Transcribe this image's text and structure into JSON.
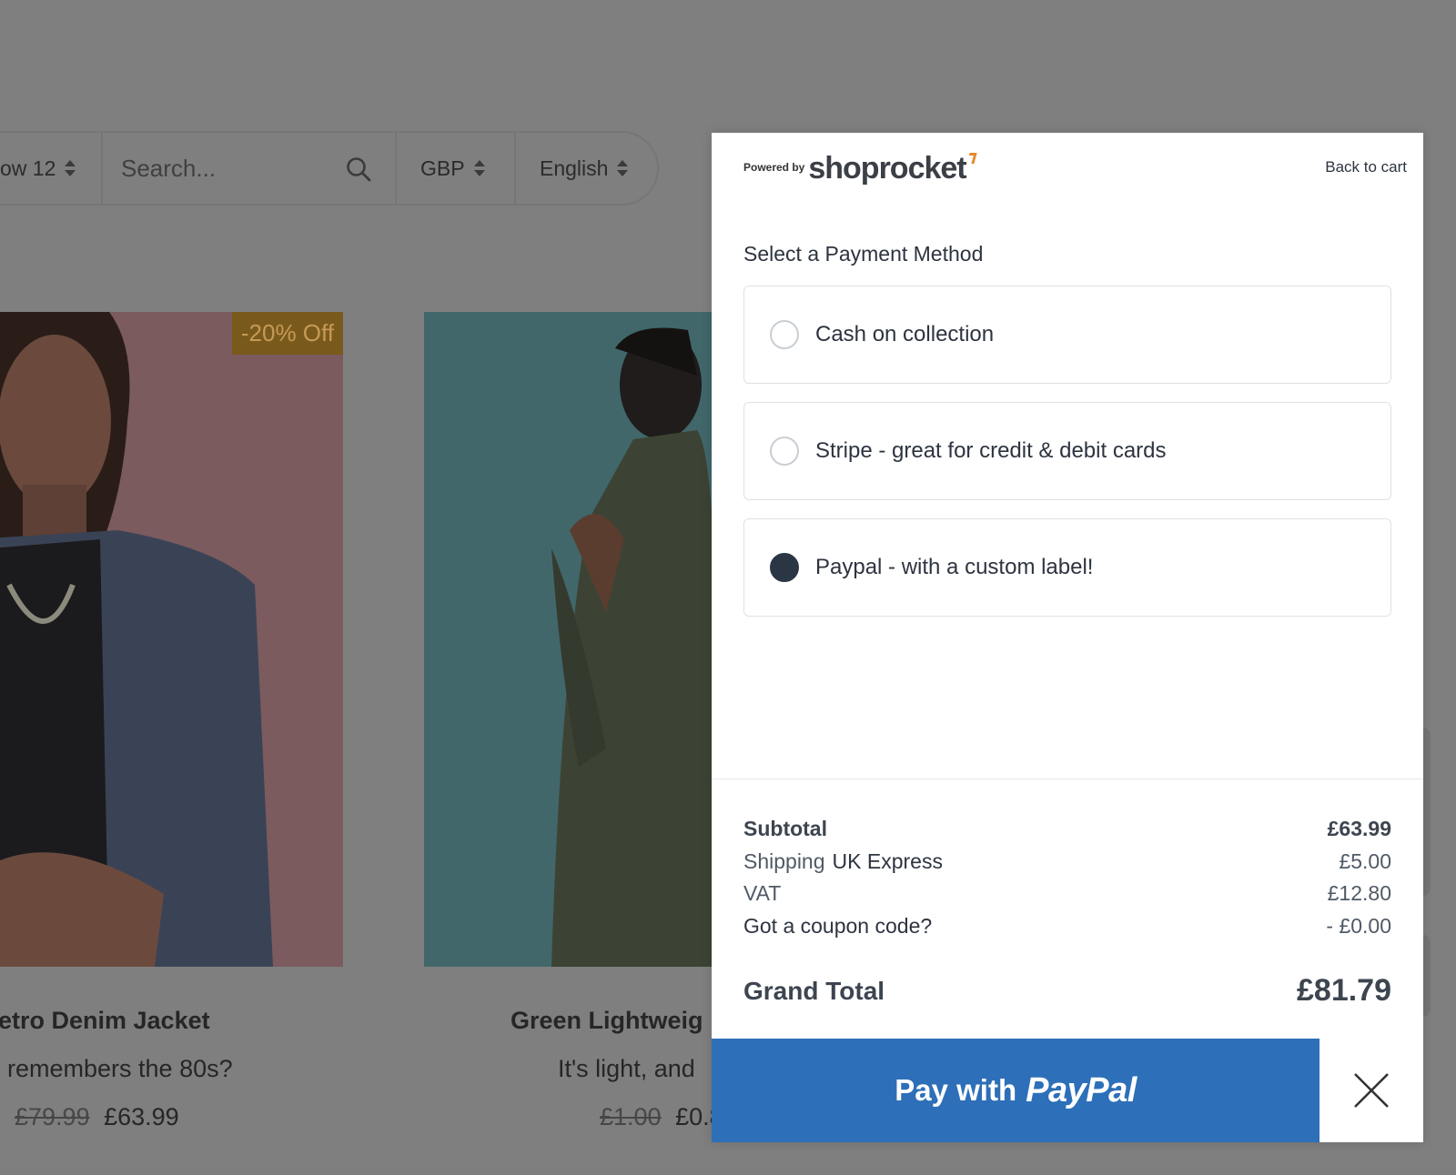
{
  "toolbar": {
    "show_label": "ow 12",
    "search_placeholder": "Search...",
    "currency": "GBP",
    "language": "English"
  },
  "products": [
    {
      "badge": "-20% Off",
      "title": "etro Denim Jacket",
      "description": " remembers the 80s?",
      "old_price": "£79.99",
      "price": "£63.99"
    },
    {
      "title": "Green Lightweig",
      "description": "It's light, and",
      "old_price": "£1.00",
      "price": "£0.8"
    }
  ],
  "checkout": {
    "powered_by": "Powered by",
    "brand": "shoprocket",
    "back_link": "Back to cart",
    "payment_title": "Select a Payment Method",
    "payment_methods": [
      {
        "label": "Cash on collection",
        "selected": false
      },
      {
        "label": "Stripe - great for credit & debit cards",
        "selected": false
      },
      {
        "label": "Paypal - with a custom label!",
        "selected": true
      }
    ],
    "summary": {
      "subtotal_label": "Subtotal",
      "subtotal": "£63.99",
      "shipping_label": "Shipping",
      "shipping_method": "UK Express",
      "shipping": "£5.00",
      "vat_label": "VAT",
      "vat": "£12.80",
      "coupon_label": "Got a coupon code?",
      "coupon": "- £0.00",
      "grand_total_label": "Grand Total",
      "grand_total": "£81.79"
    },
    "pay_button": {
      "prefix": "Pay with",
      "brand": "PayPal"
    },
    "close_icon": "close-icon"
  },
  "colors": {
    "paypal_blue": "#2d6fb8",
    "overlay": "#7f7f7f",
    "text_dark": "#2d3440",
    "badge_orange": "#7a5a1c"
  }
}
